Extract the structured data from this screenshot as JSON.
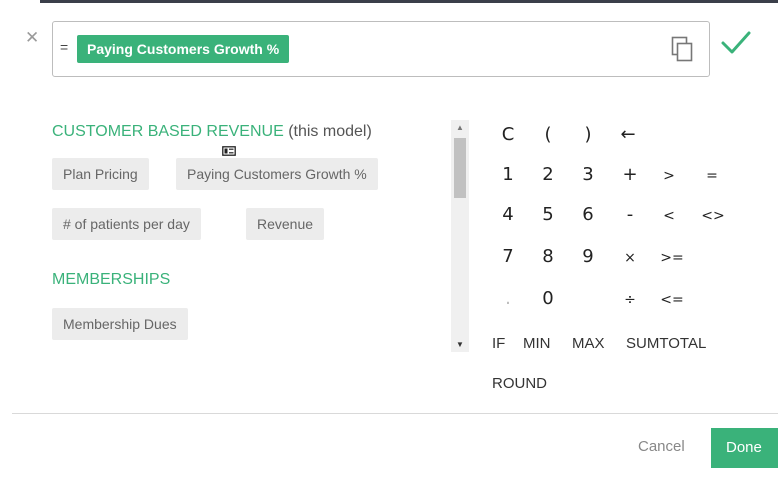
{
  "formula": {
    "prefix": "=",
    "token": "Paying Customers Growth %"
  },
  "icons": {
    "close": "close-icon",
    "copy": "copy-icon",
    "confirm": "checkmark-icon",
    "drag": "drag-handle-icon"
  },
  "colors": {
    "accent": "#3ab27a",
    "chip_bg": "#ececec"
  },
  "variables": {
    "groups": [
      {
        "title": "CUSTOMER BASED REVENUE",
        "note": "(this model)",
        "chips": [
          "Plan Pricing",
          "Paying Customers Growth %",
          "# of patients per day",
          "Revenue"
        ]
      },
      {
        "title": "MEMBERSHIPS",
        "note": "",
        "chips": [
          "Membership Dues"
        ]
      }
    ]
  },
  "keypad": {
    "row1": [
      "C",
      "(",
      ")",
      "←"
    ],
    "row2": [
      "1",
      "2",
      "3",
      "+",
      ">",
      "="
    ],
    "row3": [
      "4",
      "5",
      "6",
      "-",
      "<",
      "<>"
    ],
    "row4": [
      "7",
      "8",
      "9",
      "×",
      ">="
    ],
    "row5": [
      ".",
      "0",
      "÷",
      "<="
    ],
    "functions": [
      "IF",
      "MIN",
      "MAX",
      "SUMTOTAL",
      "ROUND"
    ]
  },
  "footer": {
    "cancel": "Cancel",
    "done": "Done"
  }
}
